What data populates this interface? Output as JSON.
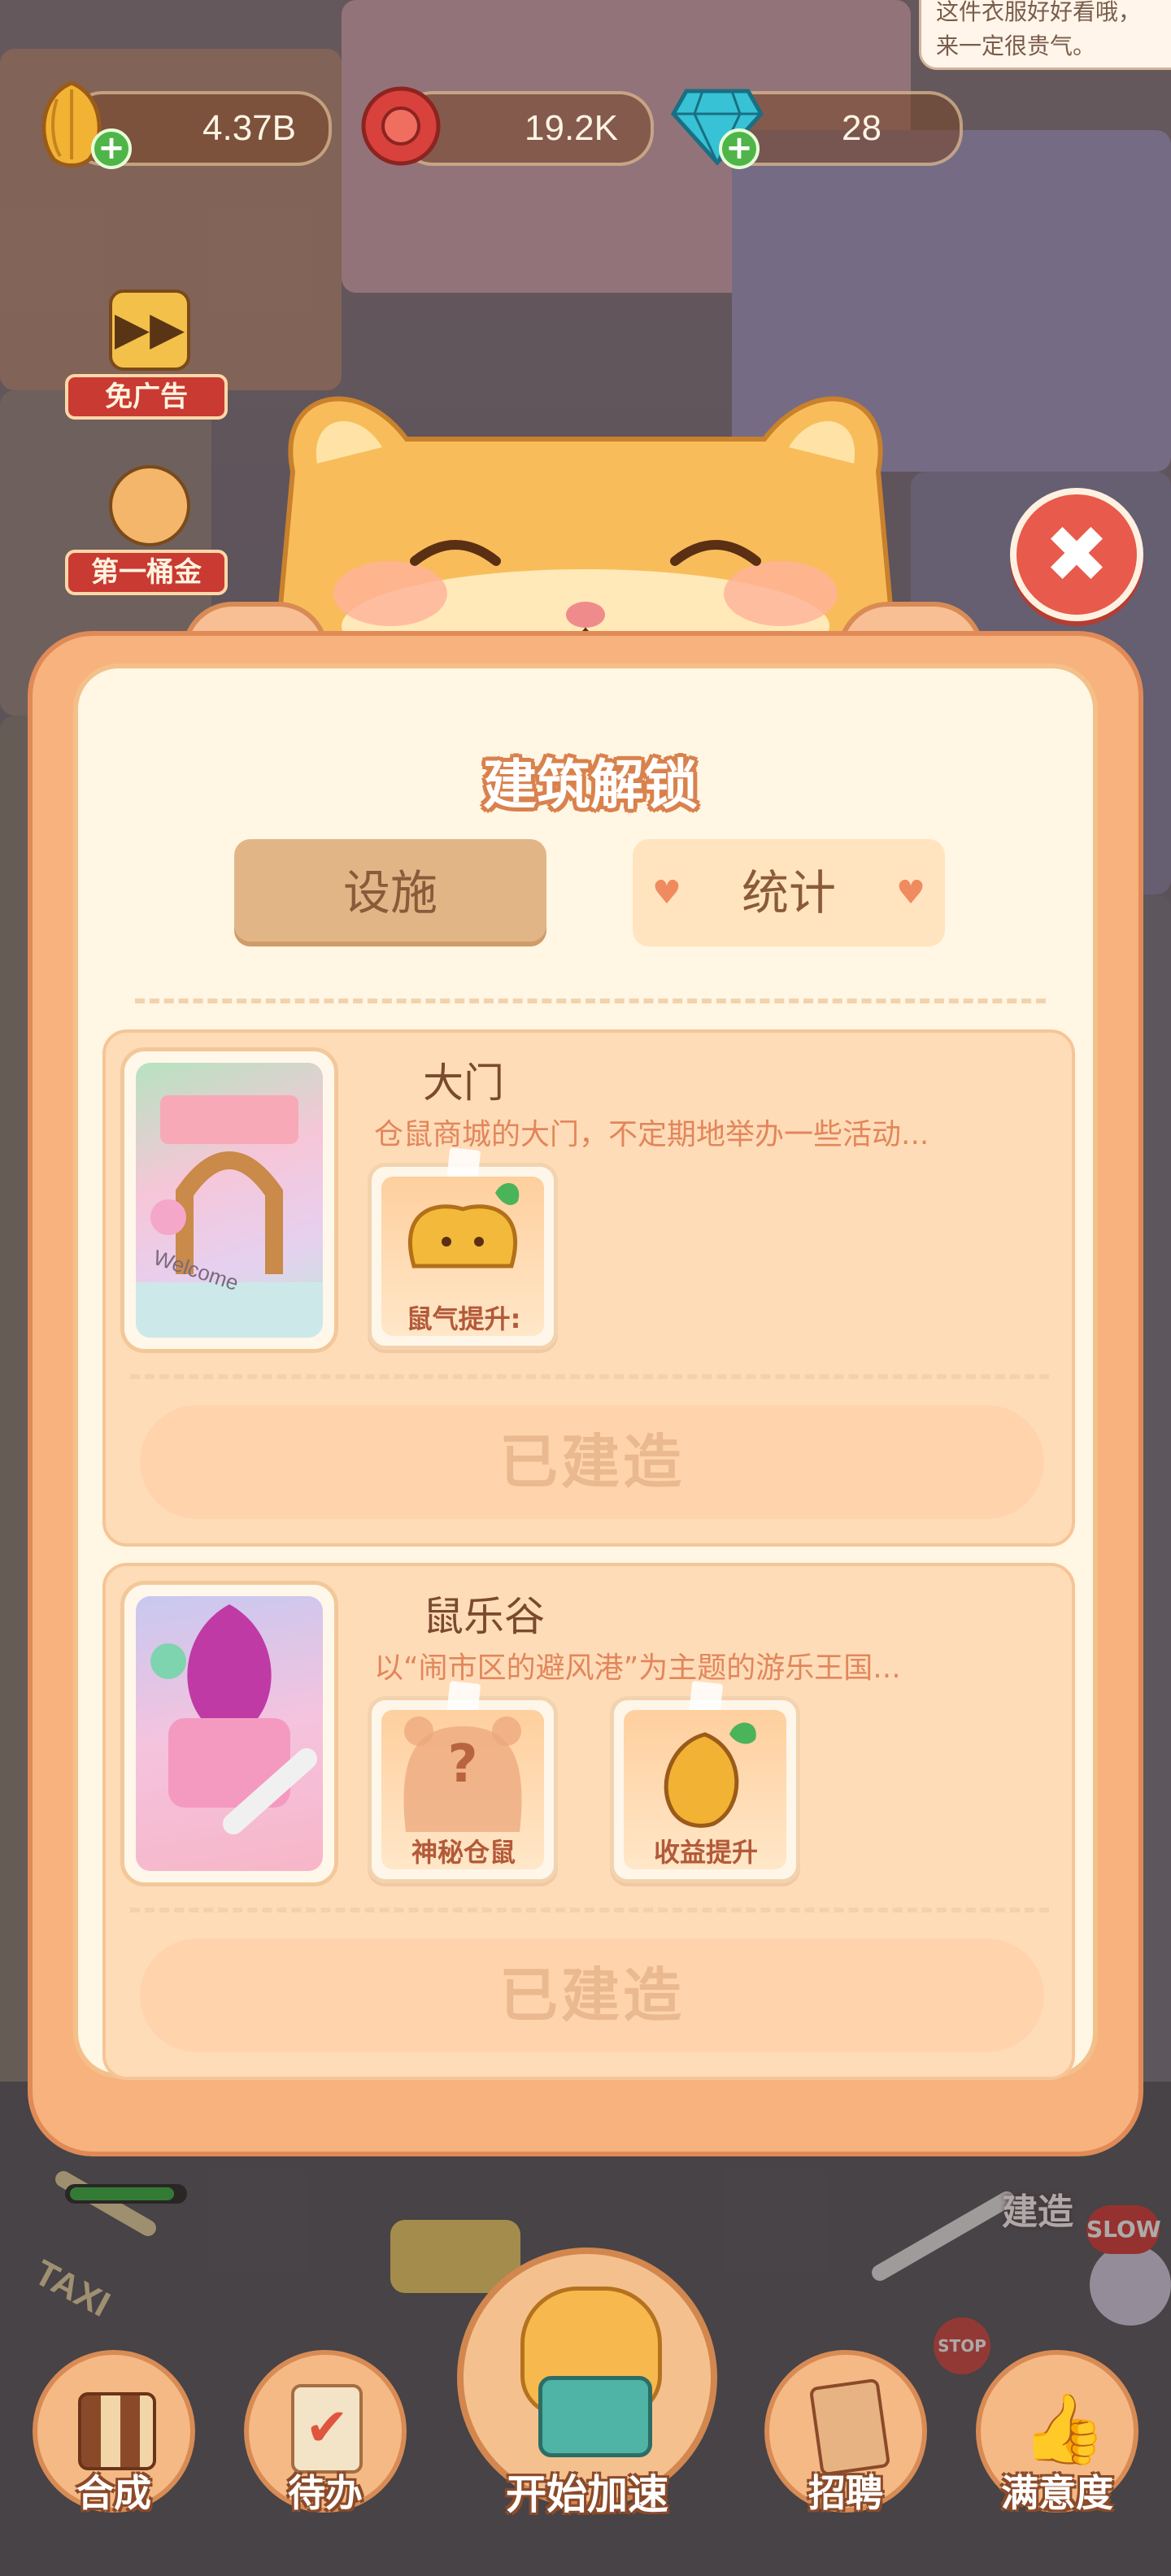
{
  "top_right_bubble": {
    "line1": "这件衣服好好看哦，",
    "line2": "来一定很贵气。"
  },
  "currencies": [
    {
      "icon": "seed-icon",
      "value": "4.37B"
    },
    {
      "icon": "flower-badge-icon",
      "value": "19.2K"
    },
    {
      "icon": "diamond-icon",
      "value": "28"
    }
  ],
  "side_buttons": [
    {
      "icon": "fast-forward-icon",
      "label": "免广告"
    },
    {
      "icon": "hamster-gold-icon",
      "label": "第一桶金"
    }
  ],
  "dialog": {
    "title": "建筑解锁",
    "tabs": [
      {
        "label": "设施",
        "active": true
      },
      {
        "label": "统计",
        "active": false
      }
    ],
    "cards": [
      {
        "name": "大门",
        "description": "仓鼠商城的大门，不定期地举办一些活动...",
        "image_caption": "Welcome",
        "bonuses": [
          {
            "icon": "hamster-face-icon",
            "label": "鼠气提升:"
          }
        ],
        "status": "已建造"
      },
      {
        "name": "鼠乐谷",
        "description": "以“闹市区的避风港”为主题的游乐王国...",
        "bonuses": [
          {
            "icon": "mystery-hamster-icon",
            "label": "神秘仓鼠",
            "mark": "?"
          },
          {
            "icon": "seed-icon",
            "label": "收益提升"
          }
        ],
        "status": "已建造"
      }
    ]
  },
  "close_button": {
    "icon": "close-icon",
    "symbol": "✖"
  },
  "world_labels": {
    "build": "建造",
    "taxi": "TAXI",
    "slow": "SLOW",
    "stop": "STOP"
  },
  "bottom_nav": [
    {
      "icon": "merge-icon",
      "label": "合成"
    },
    {
      "icon": "clipboard-check-icon",
      "label": "待办"
    },
    {
      "icon": "hamster-speed-icon",
      "label": "开始加速"
    },
    {
      "icon": "recruit-card-icon",
      "label": "招聘"
    },
    {
      "icon": "thumbs-up-icon",
      "label": "满意度"
    }
  ],
  "colors": {
    "accent": "#f7b27d",
    "panel": "#fff6e4",
    "close": "#e85a4b",
    "title_outline": "#d9824d"
  }
}
